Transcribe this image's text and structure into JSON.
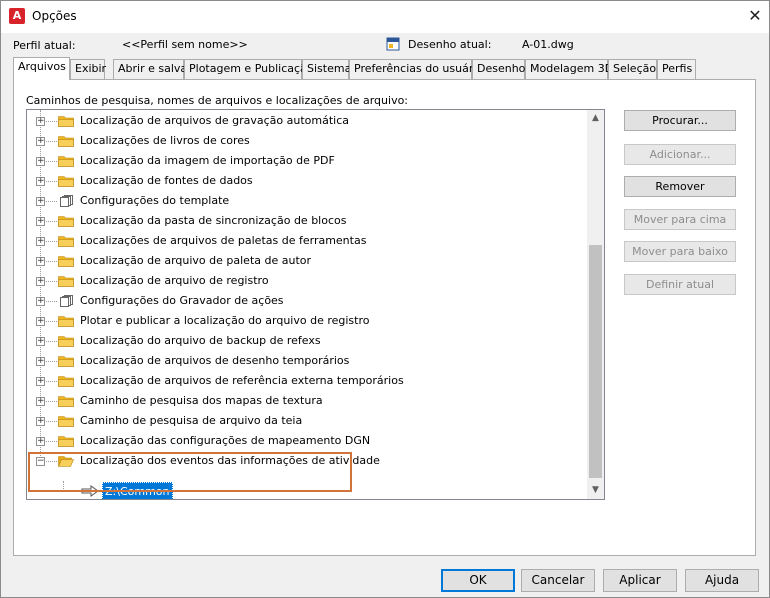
{
  "window": {
    "title": "Opções",
    "app_icon_letter": "A",
    "close_glyph": "✕"
  },
  "profile": {
    "label": "Perfil atual:",
    "value": "<<Perfil sem nome>>",
    "drawing_label": "Desenho atual:",
    "drawing_value": "A-01.dwg"
  },
  "tabs": [
    {
      "label": "Arquivos",
      "active": true
    },
    {
      "label": "Exibir"
    },
    {
      "label": "Abrir e salvar"
    },
    {
      "label": "Plotagem e Publicação"
    },
    {
      "label": "Sistema"
    },
    {
      "label": "Preferências do usuário"
    },
    {
      "label": "Desenho"
    },
    {
      "label": "Modelagem 3D"
    },
    {
      "label": "Seleção"
    },
    {
      "label": "Perfis"
    }
  ],
  "section_label": "Caminhos de pesquisa, nomes de arquivos e localizações de arquivo:",
  "tree": {
    "items": [
      {
        "label": "Localização de arquivos de gravação automática",
        "icon": "folder-icon"
      },
      {
        "label": "Localizações de livros de cores",
        "icon": "folder-icon"
      },
      {
        "label": "Localização da imagem de importação de PDF",
        "icon": "folder-icon"
      },
      {
        "label": "Localização de fontes de dados",
        "icon": "folder-icon"
      },
      {
        "label": "Configurações do template",
        "icon": "pages-icon"
      },
      {
        "label": "Localização da pasta de sincronização de blocos",
        "icon": "folder-icon"
      },
      {
        "label": "Localizações de arquivos de paletas de ferramentas",
        "icon": "folder-icon"
      },
      {
        "label": "Localização de arquivo de paleta de autor",
        "icon": "folder-icon"
      },
      {
        "label": "Localização de arquivo de registro",
        "icon": "folder-icon"
      },
      {
        "label": "Configurações do Gravador de ações",
        "icon": "pages-icon"
      },
      {
        "label": "Plotar e publicar a localização do arquivo de registro",
        "icon": "folder-icon"
      },
      {
        "label": "Localização do arquivo de backup de refexs",
        "icon": "folder-icon"
      },
      {
        "label": "Localização de arquivos de desenho temporários",
        "icon": "folder-icon"
      },
      {
        "label": "Localização de arquivos de referência externa temporários",
        "icon": "folder-icon"
      },
      {
        "label": "Caminho de pesquisa dos mapas de textura",
        "icon": "folder-icon"
      },
      {
        "label": "Caminho de pesquisa de arquivo da teia",
        "icon": "folder-icon"
      },
      {
        "label": "Localização das configurações de mapeamento DGN",
        "icon": "folder-icon"
      },
      {
        "label": "Localização dos eventos das informações de atividade",
        "icon": "folder-open-icon",
        "expanded": true
      }
    ],
    "child_value": "Z:\\Common",
    "expand_glyph": "+",
    "collapse_glyph": "−"
  },
  "scroll": {
    "up_glyph": "▲",
    "down_glyph": "▼"
  },
  "side_buttons": {
    "browse": "Procurar...",
    "add": "Adicionar...",
    "remove": "Remover",
    "move_up": "Mover para cima",
    "move_down": "Mover para baixo",
    "set_current": "Definir atual"
  },
  "footer": {
    "ok": "OK",
    "cancel": "Cancelar",
    "apply": "Aplicar",
    "help": "Ajuda"
  },
  "colors": {
    "accent": "#0078d7",
    "highlight_box": "#d0743c",
    "folder": "#f3b623"
  }
}
